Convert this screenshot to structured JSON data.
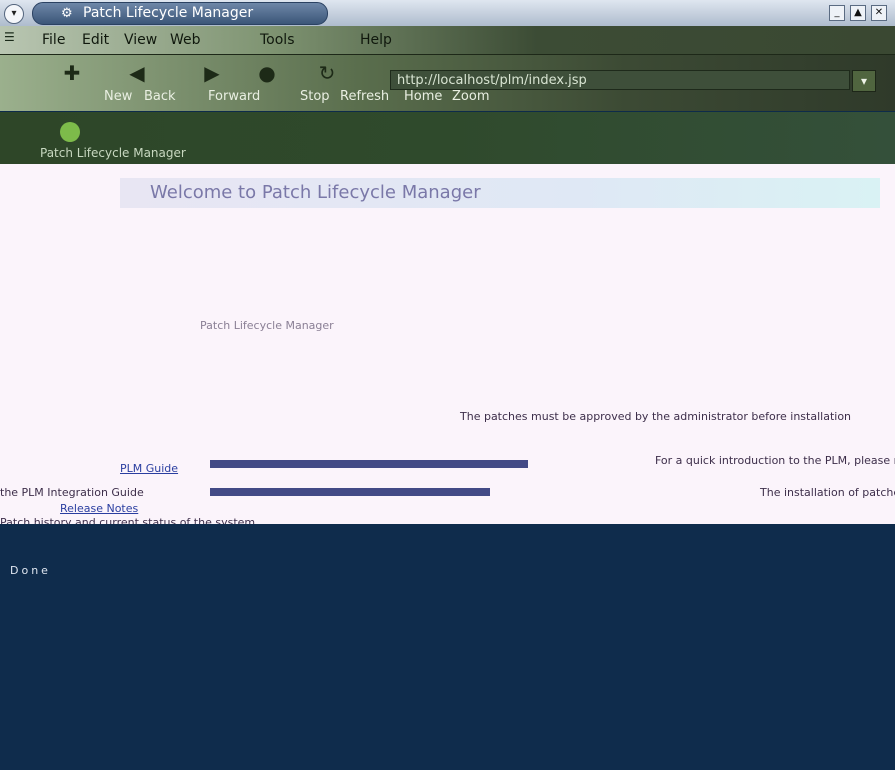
{
  "window": {
    "title": "Patch Lifecycle Manager",
    "menu_button_icon": "chevron-down-icon",
    "buttons": {
      "minimize": "_",
      "maximize": "▲",
      "close": "✕"
    }
  },
  "menubar": {
    "items": [
      "File",
      "Edit",
      "View",
      "Web",
      "Tools",
      "Help"
    ]
  },
  "toolbar": {
    "buttons": [
      "New",
      "Back",
      "Forward",
      "Stop",
      "Refresh",
      "Home",
      "Zoom"
    ],
    "url": "http://localhost/plm/index.jsp"
  },
  "banner": {
    "caption": "Patch Lifecycle Manager"
  },
  "content": {
    "heading": "Welcome to Patch Lifecycle Manager",
    "lines": [
      "Patch Lifecycle Manager",
      "The patches must be approved by the administrator before installation",
      "For a quick introduction to the PLM, please refer to",
      "the PLM Integration Guide",
      "The installation of patches is recorded in the system log",
      "Patch history and current status of the system"
    ],
    "links": [
      "PLM Guide",
      "Release Notes"
    ]
  },
  "status": {
    "text": "Done"
  },
  "colors": {
    "titlebar": "#aebccd",
    "chrome": "#3c4c35",
    "content_bg": "#fbf4fb",
    "lower_bg": "#0f2c4c",
    "link": "#2a3ea0"
  }
}
